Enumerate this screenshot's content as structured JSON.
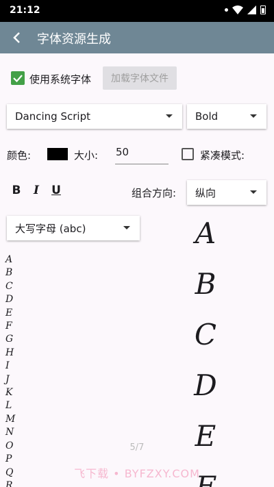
{
  "status_bar": {
    "time": "21:12"
  },
  "app_bar": {
    "title": "字体资源生成"
  },
  "options": {
    "use_system_font_label": "使用系统字体",
    "use_system_font_checked": true,
    "load_font_button": "加载字体文件"
  },
  "font": {
    "family": "Dancing Script",
    "weight": "Bold"
  },
  "style_row": {
    "color_label": "颜色:",
    "color_value": "#000000",
    "size_label": "大小:",
    "size_value": "50",
    "compact_label": "紧凑模式:",
    "compact_checked": false
  },
  "format_row": {
    "bold": "B",
    "italic": "I",
    "underline": "U",
    "direction_label": "组合方向:",
    "direction_value": "纵向"
  },
  "charset": {
    "selected": "大写字母 (abc)"
  },
  "glyph_list": [
    "A",
    "B",
    "C",
    "D",
    "E",
    "F",
    "G",
    "H",
    "I",
    "J",
    "K",
    "L",
    "M",
    "N",
    "O",
    "P",
    "Q",
    "R"
  ],
  "preview": [
    "A",
    "B",
    "C",
    "D",
    "E",
    "F"
  ],
  "page_indicator": "5/7",
  "watermark": "飞下载 • BYFZXY.COM"
}
